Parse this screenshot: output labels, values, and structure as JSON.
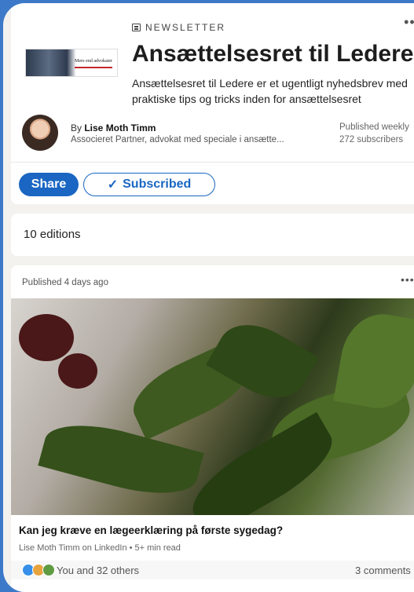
{
  "newsletter": {
    "label": "NEWSLETTER",
    "title": "Ansættelsesret til Ledere",
    "description": "Ansættelsesret til Ledere er et ugentligt nyhedsbrev med praktiske tips og tricks inden for ansættelsesret",
    "logo_text": "Mere end advokater",
    "author_prefix": "By ",
    "author_name": "Lise Moth Timm",
    "author_role": "Associeret Partner, advokat med speciale i ansætte...",
    "frequency": "Published weekly",
    "subscribers": "272 subscribers"
  },
  "actions": {
    "share_label": "Share",
    "subscribed_label": "Subscribed",
    "check_glyph": "✓"
  },
  "editions": {
    "label": "10 editions",
    "count": 10
  },
  "post": {
    "published": "Published 4 days ago",
    "article_title": "Kan jeg kræve en lægeerklæring på første sygedag?",
    "article_meta": "Lise Moth Timm on LinkedIn • 5+ min read",
    "reactions_text": "You and 32 others",
    "comments_text": "3 comments"
  },
  "icons": {
    "more": "more-icon",
    "newsletter": "newsletter-icon",
    "reactions": [
      "like-icon",
      "celebrate-icon",
      "support-icon"
    ]
  },
  "colors": {
    "accent": "#1a66c2",
    "background": "#3d79c9",
    "page": "#f3f2ef"
  }
}
